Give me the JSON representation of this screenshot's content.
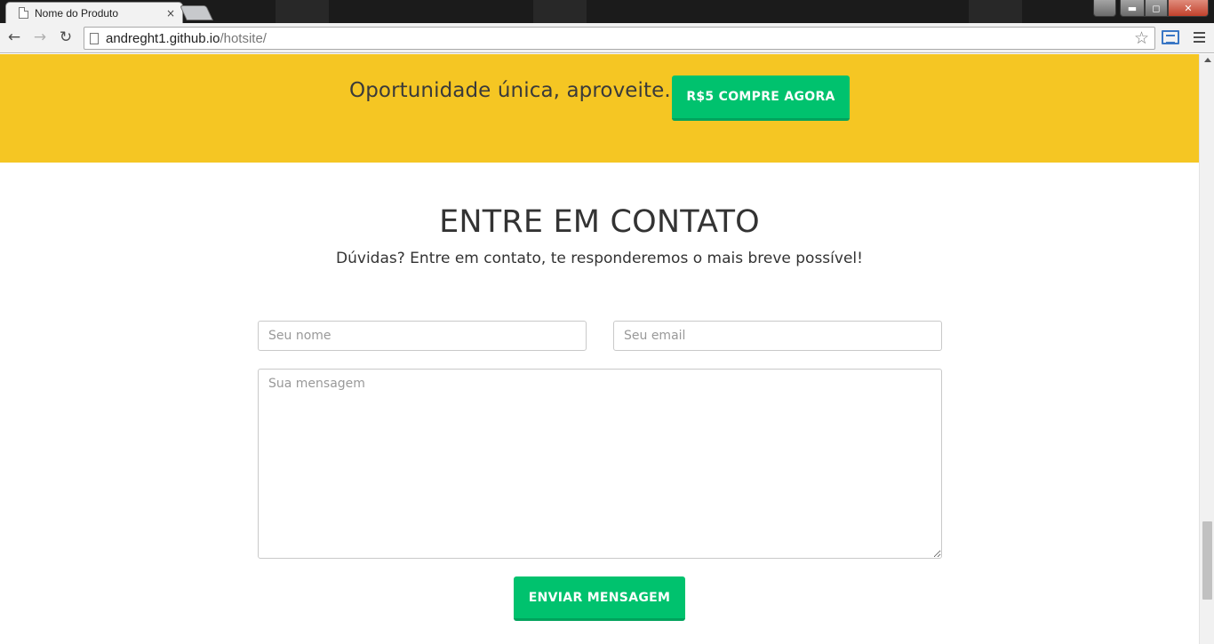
{
  "browser": {
    "tab_title": "Nome do Produto",
    "tab_close": "×",
    "url_host": "andreght1.github.io",
    "url_path": "/hotsite/",
    "back_glyph": "←",
    "forward_glyph": "→",
    "reload_glyph": "↻",
    "star_glyph": "☆",
    "min_glyph": "▬",
    "max_glyph": "◻",
    "close_glyph": "✕",
    "user_glyph": "👤"
  },
  "promo": {
    "text": "Oportunidade única, aproveite.",
    "button_label": "R$5 COMPRE AGORA",
    "bg_color": "#f5c623",
    "button_color": "#00c26e"
  },
  "contact": {
    "title": "ENTRE EM CONTATO",
    "subtitle": "Dúvidas? Entre em contato, te responderemos o mais breve possível!",
    "name_placeholder": "Seu nome",
    "email_placeholder": "Seu email",
    "message_placeholder": "Sua mensagem",
    "send_label": "ENVIAR MENSAGEM"
  }
}
